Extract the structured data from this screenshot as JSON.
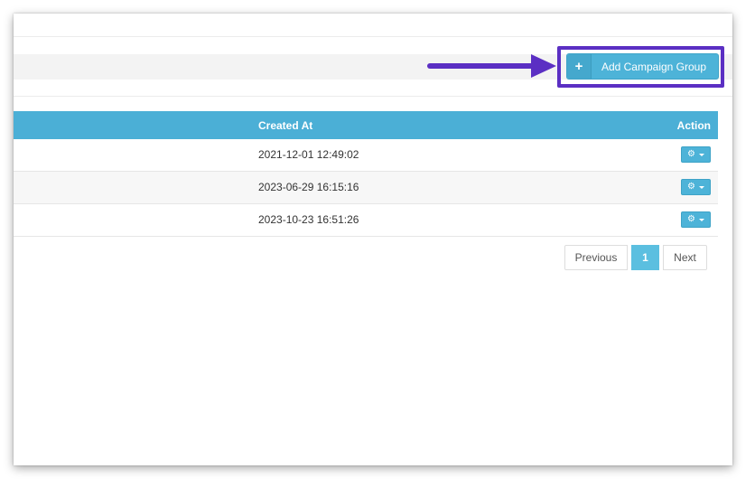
{
  "toolbar": {
    "add_button_icon": "+",
    "add_button_label": "Add Campaign Group"
  },
  "table": {
    "headers": {
      "created_at": "Created At",
      "action": "Action"
    },
    "rows": [
      {
        "created_at": "2021-12-01 12:49:02"
      },
      {
        "created_at": "2023-06-29 16:15:16"
      },
      {
        "created_at": "2023-10-23 16:51:26"
      }
    ]
  },
  "pagination": {
    "previous": "Previous",
    "current": "1",
    "next": "Next"
  },
  "colors": {
    "accent": "#4bafd6",
    "highlight_border": "#5b2fc3",
    "arrow": "#5b2fc3"
  },
  "icons": {
    "plus": "plus-icon",
    "gear": "gear-icon",
    "caret": "caret-down-icon",
    "arrow": "pointer-arrow-icon"
  }
}
